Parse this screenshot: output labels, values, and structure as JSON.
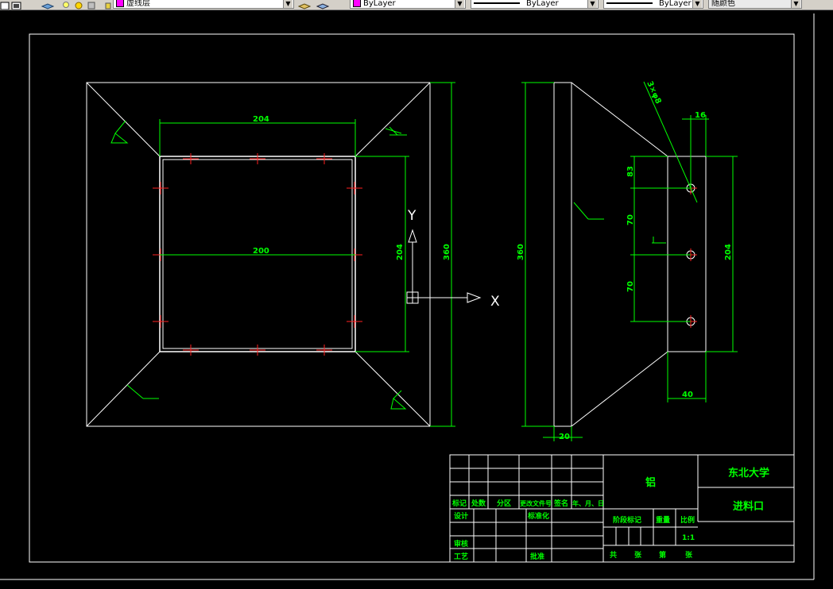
{
  "toolbar": {
    "layer_name": "虚线层",
    "color_value": "ByLayer",
    "linetype_value": "ByLayer",
    "lineweight_value": "ByLayer",
    "plotstyle_value": "随颜色"
  },
  "dimensions": {
    "top_width": "204",
    "inner_width": "200",
    "inner_height": "204",
    "outer_height": "360",
    "side_height": "360",
    "side_thickness": "20",
    "hole_spec": "3×φ8",
    "hole_offset": "16",
    "hole_top": "83",
    "hole_pitch_1": "70",
    "hole_pitch_2": "70",
    "flange_height": "204",
    "flange_width": "40"
  },
  "ucs": {
    "x_label": "X",
    "y_label": "Y"
  },
  "title_block": {
    "material": "铝",
    "university": "东北大学",
    "part_name": "进料口",
    "headers": [
      "标记",
      "处数",
      "分区",
      "更改文件号",
      "签名",
      "年、月、日"
    ],
    "designer": "设计",
    "standardization": "标准化",
    "review": "审核",
    "process": "工艺",
    "approve": "批准",
    "stage_mark": "阶段标记",
    "weight": "重量",
    "scale_label": "比例",
    "scale_value": "1:1",
    "total_label": "共",
    "sheets_label": "张",
    "page_label": "第",
    "page_sheet_label": "张"
  }
}
